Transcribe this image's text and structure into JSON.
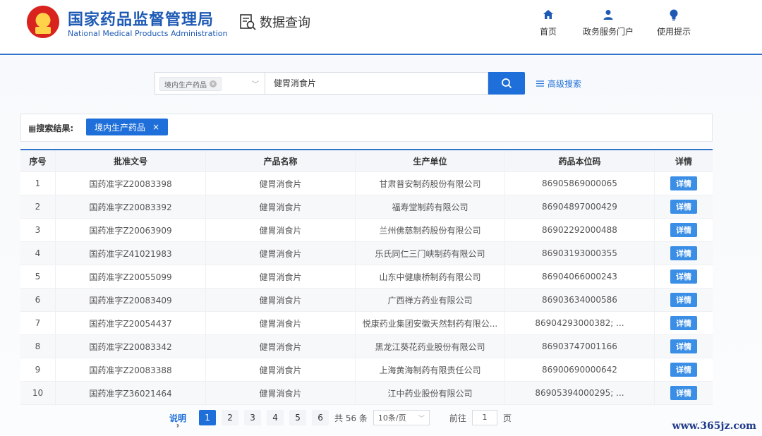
{
  "header": {
    "org_cn": "国家药品监督管理局",
    "org_en": "National Medical Products Administration",
    "section": "数据查询",
    "nav": [
      {
        "label": "首页",
        "icon": "home-icon"
      },
      {
        "label": "政务服务门户",
        "icon": "user-icon"
      },
      {
        "label": "使用提示",
        "icon": "bulb-icon"
      }
    ]
  },
  "search": {
    "category_tag": "境内生产药品",
    "query": "健胃消食片",
    "advanced_label": "高级搜索"
  },
  "results": {
    "label": "搜索结果:",
    "tag": "境内生产药品",
    "tag_close": "×"
  },
  "table": {
    "columns": [
      "序号",
      "批准文号",
      "产品名称",
      "生产单位",
      "药品本位码",
      "详情"
    ],
    "detail_label": "详情",
    "rows": [
      [
        "1",
        "国药准字Z20083398",
        "健胃消食片",
        "甘肃普安制药股份有限公司",
        "86905869000065"
      ],
      [
        "2",
        "国药准字Z20083392",
        "健胃消食片",
        "福寿堂制药有限公司",
        "86904897000429"
      ],
      [
        "3",
        "国药准字Z20063909",
        "健胃消食片",
        "兰州佛慈制药股份有限公司",
        "86902292000488"
      ],
      [
        "4",
        "国药准字Z41021983",
        "健胃消食片",
        "乐氏同仁三门峡制药有限公司",
        "86903193000355"
      ],
      [
        "5",
        "国药准字Z20055099",
        "健胃消食片",
        "山东中健康桥制药有限公司",
        "86904066000243"
      ],
      [
        "6",
        "国药准字Z20083409",
        "健胃消食片",
        "广西禅方药业有限公司",
        "86903634000586"
      ],
      [
        "7",
        "国药准字Z20054437",
        "健胃消食片",
        "悦康药业集团安徽天然制药有限公...",
        "86904293000382; ..."
      ],
      [
        "8",
        "国药准字Z20083342",
        "健胃消食片",
        "黑龙江葵花药业股份有限公司",
        "86903747001166"
      ],
      [
        "9",
        "国药准字Z20083388",
        "健胃消食片",
        "上海黄海制药有限责任公司",
        "86900690000642"
      ],
      [
        "10",
        "国药准字Z36021464",
        "健胃消食片",
        "江中药业股份有限公司",
        "86905394000295; ..."
      ]
    ]
  },
  "pager": {
    "explain": "说明",
    "prev": "‹",
    "next": "›",
    "pages": [
      "1",
      "2",
      "3",
      "4",
      "5",
      "6"
    ],
    "active_page": "1",
    "total": "共 56 条",
    "page_size": "10条/页",
    "goto_label": "前往",
    "goto_value": "1",
    "page_unit": "页"
  },
  "watermark": "www.365jz.com"
}
